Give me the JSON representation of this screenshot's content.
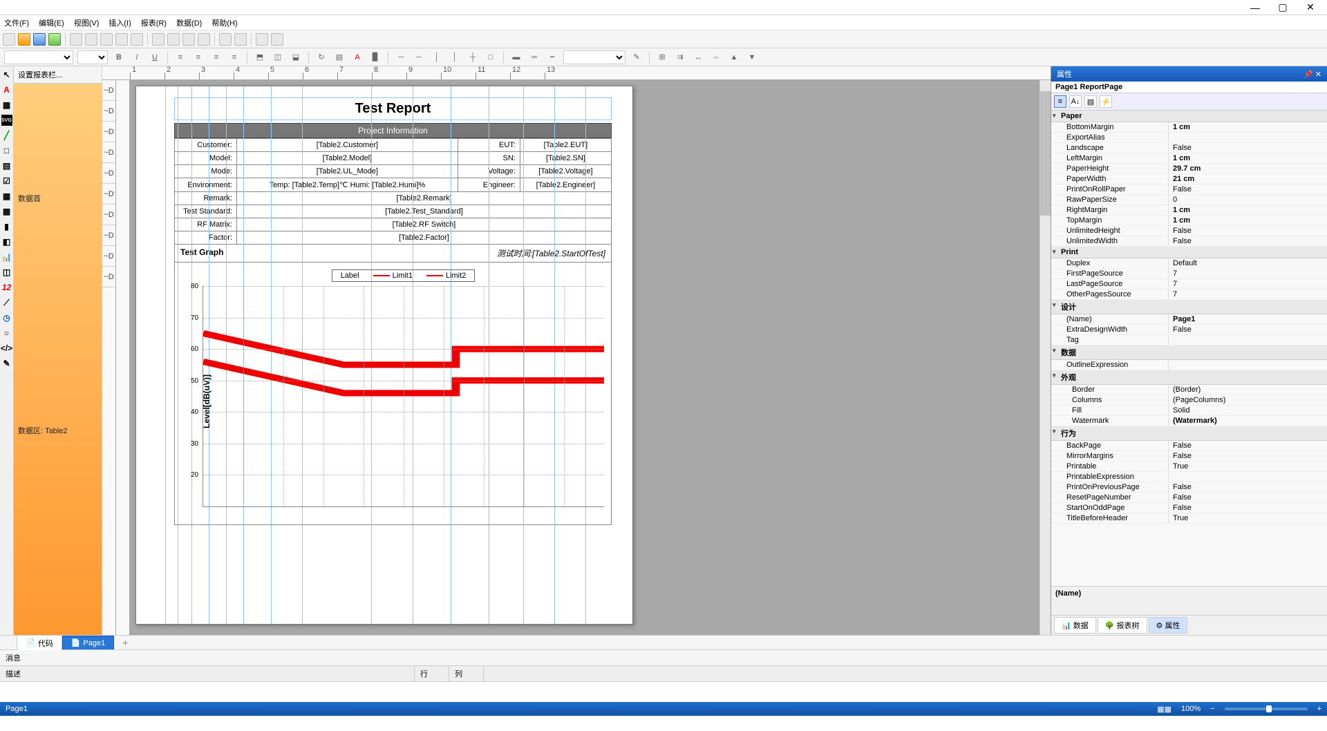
{
  "window": {
    "min": "—",
    "max": "▢",
    "close": "✕"
  },
  "menu": [
    "文件(F)",
    "编辑(E)",
    "视图(V)",
    "插入(I)",
    "报表(R)",
    "数据(D)",
    "帮助(H)"
  ],
  "fmt": {
    "bold": "B",
    "italic": "I",
    "underline": "U"
  },
  "data_panel": {
    "title": "设置报表栏...",
    "header": "数据首",
    "body": "数据区: Table2"
  },
  "ruler_ticks": [
    "1",
    "2",
    "3",
    "4",
    "5",
    "6",
    "7",
    "8",
    "9",
    "10",
    "11",
    "12",
    "13"
  ],
  "band_labels": [
    "~D",
    "~D",
    "~D",
    "~D",
    "~D",
    "~D",
    "~D",
    "~D",
    "~D",
    "~D"
  ],
  "report": {
    "title": "Test Report",
    "section_header": "Project Information",
    "rows": [
      [
        {
          "lbl": "Customer:",
          "val": "[Table2.Customer]"
        },
        {
          "lbl": "EUT:",
          "val": "[Table2.EUT]"
        }
      ],
      [
        {
          "lbl": "Model:",
          "val": "[Table2.Model]"
        },
        {
          "lbl": "SN:",
          "val": "[Table2.SN]"
        }
      ],
      [
        {
          "lbl": "Mode:",
          "val": "[Table2.UL_Mode]"
        },
        {
          "lbl": "Voltage:",
          "val": "[Table2.Voltage]"
        }
      ],
      [
        {
          "lbl": "Environment:",
          "val": "Temp: [Table2.Temp]℃  Humi: [Table2.Humi]%"
        },
        {
          "lbl": "Engineer:",
          "val": "[Table2.Engineer]"
        }
      ],
      [
        {
          "lbl": "Remark:",
          "val": "[Table2.Remark]",
          "span": 3
        }
      ],
      [
        {
          "lbl": "Test Standard:",
          "val": "[Table2.Test_Standard]",
          "span": 3
        }
      ],
      [
        {
          "lbl": "RF Matrix:",
          "val": "[Table2.RF Switch]",
          "span": 3
        }
      ],
      [
        {
          "lbl": "Factor:",
          "val": "[Table2.Factor]",
          "span": 3
        }
      ]
    ],
    "graph_header_left": "Test Graph",
    "graph_header_right": "测试时间:[Table2.StartOfTest]"
  },
  "chart_data": {
    "type": "line",
    "legend": [
      "Label",
      "Limit1",
      "Limit2"
    ],
    "ylabel": "Level[dB(uV)]",
    "ylim": [
      10,
      80
    ],
    "yticks": [
      20,
      30,
      40,
      50,
      60,
      70,
      80
    ],
    "series": [
      {
        "name": "Limit1",
        "points": [
          [
            0,
            65
          ],
          [
            35,
            55
          ],
          [
            63,
            55
          ],
          [
            63,
            60
          ],
          [
            100,
            60
          ]
        ]
      },
      {
        "name": "Limit2",
        "points": [
          [
            0,
            56
          ],
          [
            35,
            46
          ],
          [
            63,
            46
          ],
          [
            63,
            50
          ],
          [
            100,
            50
          ]
        ]
      }
    ]
  },
  "props": {
    "title": "属性",
    "object": "Page1 ReportPage",
    "groups": [
      {
        "name": "Paper",
        "items": [
          {
            "k": "BottomMargin",
            "v": "1 cm",
            "bold": true
          },
          {
            "k": "ExportAlias",
            "v": ""
          },
          {
            "k": "Landscape",
            "v": "False"
          },
          {
            "k": "LeftMargin",
            "v": "1 cm",
            "bold": true
          },
          {
            "k": "PaperHeight",
            "v": "29.7 cm",
            "bold": true
          },
          {
            "k": "PaperWidth",
            "v": "21 cm",
            "bold": true
          },
          {
            "k": "PrintOnRollPaper",
            "v": "False"
          },
          {
            "k": "RawPaperSize",
            "v": "0"
          },
          {
            "k": "RightMargin",
            "v": "1 cm",
            "bold": true
          },
          {
            "k": "TopMargin",
            "v": "1 cm",
            "bold": true
          },
          {
            "k": "UnlimitedHeight",
            "v": "False"
          },
          {
            "k": "UnlimitedWidth",
            "v": "False"
          }
        ]
      },
      {
        "name": "Print",
        "items": [
          {
            "k": "Duplex",
            "v": "Default"
          },
          {
            "k": "FirstPageSource",
            "v": "7"
          },
          {
            "k": "LastPageSource",
            "v": "7"
          },
          {
            "k": "OtherPagesSource",
            "v": "7"
          }
        ]
      },
      {
        "name": "设计",
        "items": [
          {
            "k": "(Name)",
            "v": "Page1",
            "bold": true
          },
          {
            "k": "ExtraDesignWidth",
            "v": "False"
          },
          {
            "k": "Tag",
            "v": ""
          }
        ]
      },
      {
        "name": "数据",
        "items": [
          {
            "k": "OutlineExpression",
            "v": ""
          }
        ]
      },
      {
        "name": "外观",
        "items": [
          {
            "k": "Border",
            "v": "(Border)",
            "sub": true
          },
          {
            "k": "Columns",
            "v": "(PageColumns)",
            "sub": true
          },
          {
            "k": "Fill",
            "v": "Solid",
            "sub": true
          },
          {
            "k": "Watermark",
            "v": "(Watermark)",
            "bold": true,
            "sub": true
          }
        ]
      },
      {
        "name": "行为",
        "items": [
          {
            "k": "BackPage",
            "v": "False"
          },
          {
            "k": "MirrorMargins",
            "v": "False"
          },
          {
            "k": "Printable",
            "v": "True"
          },
          {
            "k": "PrintableExpression",
            "v": ""
          },
          {
            "k": "PrintOnPreviousPage",
            "v": "False"
          },
          {
            "k": "ResetPageNumber",
            "v": "False"
          },
          {
            "k": "StartOnOddPage",
            "v": "False"
          },
          {
            "k": "TitleBeforeHeader",
            "v": "True"
          }
        ]
      }
    ],
    "desc_label": "(Name)",
    "bottom_tabs": [
      "数据",
      "报表树",
      "属性"
    ]
  },
  "bottom_tabs": {
    "code": "代码",
    "page": "Page1",
    "add": "+"
  },
  "msg": {
    "hdr": "消息",
    "col1": "描述",
    "col2": "行",
    "col3": "列"
  },
  "status": {
    "left": "Page1",
    "zoom": "100%",
    "minus": "−",
    "plus": "+"
  }
}
